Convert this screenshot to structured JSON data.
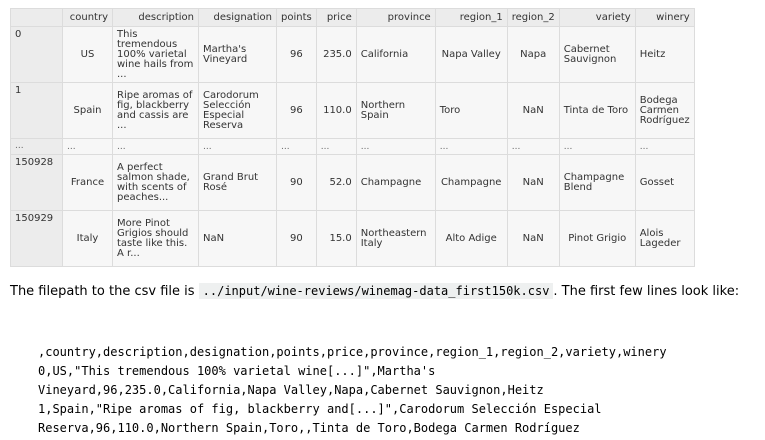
{
  "table": {
    "columns": [
      "country",
      "description",
      "designation",
      "points",
      "price",
      "province",
      "region_1",
      "region_2",
      "variety",
      "winery"
    ],
    "rows": [
      {
        "index": "0",
        "cells": [
          "US",
          "This tremendous 100% varietal wine hails from ...",
          "Martha's Vineyard",
          "96",
          "235.0",
          "California",
          "Napa Valley",
          "Napa",
          "Cabernet Sauvignon",
          "Heitz"
        ]
      },
      {
        "index": "1",
        "cells": [
          "Spain",
          "Ripe aromas of fig, blackberry and cassis are ...",
          "Carodorum Selección Especial Reserva",
          "96",
          "110.0",
          "Northern Spain",
          "Toro",
          "NaN",
          "Tinta de Toro",
          "Bodega Carmen Rodríguez"
        ]
      },
      {
        "index": "...",
        "cells": [
          "...",
          "...",
          "...",
          "...",
          "...",
          "...",
          "...",
          "...",
          "...",
          "..."
        ]
      },
      {
        "index": "150928",
        "cells": [
          "France",
          "A perfect salmon shade, with scents of peaches...",
          "Grand Brut Rosé",
          "90",
          "52.0",
          "Champagne",
          "Champagne",
          "NaN",
          "Champagne Blend",
          "Gosset"
        ]
      },
      {
        "index": "150929",
        "cells": [
          "Italy",
          "More Pinot Grigios should taste like this. A r...",
          "NaN",
          "90",
          "15.0",
          "Northeastern Italy",
          "Alto Adige",
          "NaN",
          "Pinot Grigio",
          "Alois Lageder"
        ]
      }
    ]
  },
  "prose": {
    "before": "The filepath to the csv file is ",
    "code": "../input/wine-reviews/winemag-data_first150k.csv",
    "after": ". The first few lines look like:"
  },
  "code_lines": [
    ",country,description,designation,points,price,province,region_1,region_2,variety,winery",
    "0,US,\"This tremendous 100% varietal wine[...]\",Martha's",
    "Vineyard,96,235.0,California,Napa Valley,Napa,Cabernet Sauvignon,Heitz",
    "1,Spain,\"Ripe aromas of fig, blackberry and[...]\",Carodorum Selección Especial",
    "Reserva,96,110.0,Northern Spain,Toro,,Tinta de Toro,Bodega Carmen Rodríguez"
  ]
}
